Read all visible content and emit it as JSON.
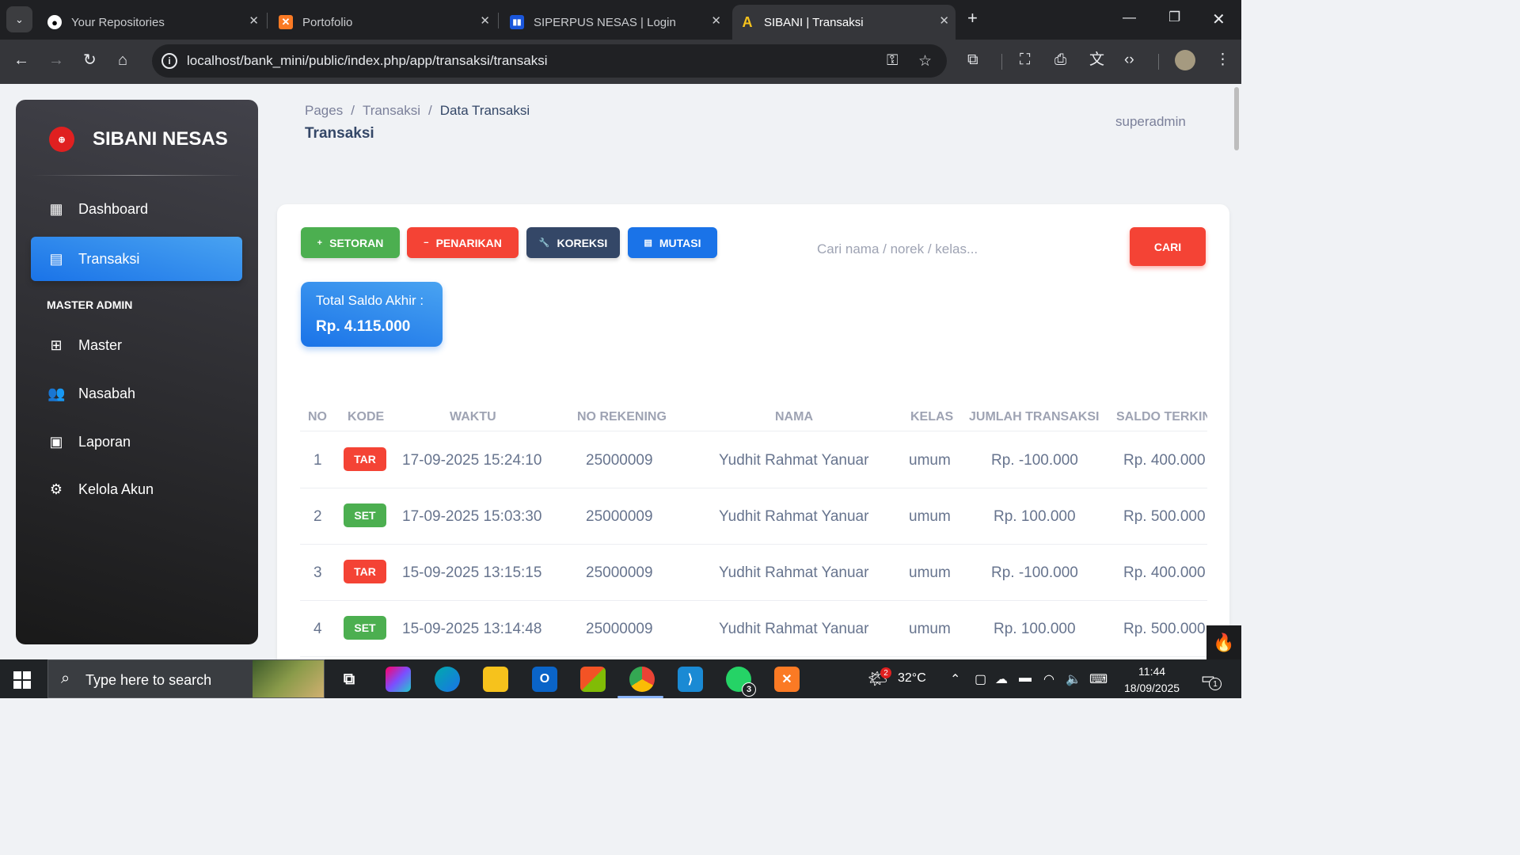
{
  "browser": {
    "tabs": [
      {
        "title": "Your Repositories",
        "icon": "github-icon"
      },
      {
        "title": "Portofolio",
        "icon": "xampp-icon"
      },
      {
        "title": "SIPERPUS NESAS | Login",
        "icon": "book-icon"
      },
      {
        "title": "SIBANI | Transaksi",
        "icon": "sibani-icon"
      }
    ],
    "url": "localhost/bank_mini/public/index.php/app/transaksi/transaksi"
  },
  "sidebar": {
    "brand": "SIBANI NESAS",
    "items": [
      {
        "label": "Dashboard",
        "icon": "dashboard-icon"
      },
      {
        "label": "Transaksi",
        "icon": "receipt-icon",
        "active": true
      }
    ],
    "section_title": "MASTER ADMIN",
    "admin_items": [
      {
        "label": "Master",
        "icon": "apps-icon"
      },
      {
        "label": "Nasabah",
        "icon": "group-icon"
      },
      {
        "label": "Laporan",
        "icon": "report-icon"
      },
      {
        "label": "Kelola Akun",
        "icon": "manage-accounts-icon"
      }
    ]
  },
  "header": {
    "breadcrumb": [
      "Pages",
      "Transaksi",
      "Data Transaksi"
    ],
    "title": "Transaksi",
    "user": "superadmin"
  },
  "actions": {
    "setoran": "SETORAN",
    "penarikan": "PENARIKAN",
    "koreksi": "KOREKSI",
    "mutasi": "MUTASI",
    "search_placeholder": "Cari nama / norek / kelas...",
    "search_button": "CARI"
  },
  "summary": {
    "label": "Total Saldo Akhir :",
    "value": "Rp. 4.115.000"
  },
  "table": {
    "columns": [
      "NO",
      "KODE",
      "WAKTU",
      "NO REKENING",
      "NAMA",
      "KELAS",
      "JUMLAH TRANSAKSI",
      "SALDO TERKIN"
    ],
    "rows": [
      {
        "no": "1",
        "kode": "TAR",
        "waktu": "17-09-2025 15:24:10",
        "norek": "25000009",
        "nama": "Yudhit Rahmat Yanuar",
        "kelas": "umum",
        "jumlah": "Rp. -100.000",
        "saldo": "Rp. 400.000"
      },
      {
        "no": "2",
        "kode": "SET",
        "waktu": "17-09-2025 15:03:30",
        "norek": "25000009",
        "nama": "Yudhit Rahmat Yanuar",
        "kelas": "umum",
        "jumlah": "Rp. 100.000",
        "saldo": "Rp. 500.000"
      },
      {
        "no": "3",
        "kode": "TAR",
        "waktu": "15-09-2025 13:15:15",
        "norek": "25000009",
        "nama": "Yudhit Rahmat Yanuar",
        "kelas": "umum",
        "jumlah": "Rp. -100.000",
        "saldo": "Rp. 400.000"
      },
      {
        "no": "4",
        "kode": "SET",
        "waktu": "15-09-2025 13:14:48",
        "norek": "25000009",
        "nama": "Yudhit Rahmat Yanuar",
        "kelas": "umum",
        "jumlah": "Rp. 100.000",
        "saldo": "Rp. 500.000"
      }
    ]
  },
  "taskbar": {
    "search_placeholder": "Type here to search",
    "weather": "32°C",
    "weather_badge": "2",
    "whatsapp_badge": "3",
    "time": "11:44",
    "date": "18/09/2025",
    "notification_count": "1"
  },
  "colors": {
    "setoran": "#4caf50",
    "penarikan": "#f44335",
    "koreksi": "#344767",
    "mutasi": "#1a73e8",
    "sidebar_active": "#1a73e8"
  }
}
